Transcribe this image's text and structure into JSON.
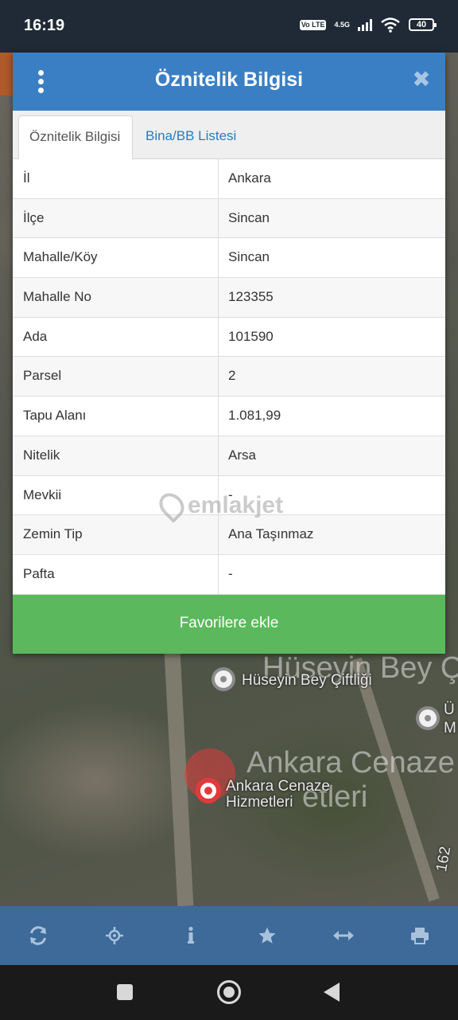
{
  "status_bar": {
    "time": "16:19",
    "volte": "Vo LTE",
    "network": "4.5G",
    "battery": "40"
  },
  "dialog": {
    "title": "Öznitelik Bilgisi",
    "tabs": [
      {
        "label": "Öznitelik Bilgisi",
        "active": true
      },
      {
        "label": "Bina/BB Listesi",
        "active": false
      }
    ],
    "rows": [
      {
        "key": "İl",
        "value": "Ankara"
      },
      {
        "key": "İlçe",
        "value": "Sincan"
      },
      {
        "key": "Mahalle/Köy",
        "value": "Sincan"
      },
      {
        "key": "Mahalle No",
        "value": "123355"
      },
      {
        "key": "Ada",
        "value": "101590"
      },
      {
        "key": "Parsel",
        "value": "2"
      },
      {
        "key": "Tapu Alanı",
        "value": "1.081,99"
      },
      {
        "key": "Nitelik",
        "value": "Arsa"
      },
      {
        "key": "Mevkii",
        "value": "-"
      },
      {
        "key": "Zemin Tip",
        "value": "Ana Taşınmaz"
      },
      {
        "key": "Pafta",
        "value": "-"
      }
    ],
    "favorite_button": "Favorilere ekle"
  },
  "watermark": "emlakjet",
  "map": {
    "labels": {
      "huseyin_big": "Hüseyin Bey Ç",
      "huseyin_small": "Hüseyin Bey Çiftliği",
      "cenaze_big": "Ankara Cenaze",
      "cenaze_big2": "etleri",
      "cenaze_small_1": "Ankara Cenaze",
      "cenaze_small_2": "Hizmetleri",
      "right_edge_1": "Ü",
      "right_edge_2": "M",
      "road_number": "162"
    }
  },
  "toolbar": {
    "icons": [
      "refresh-icon",
      "locate-icon",
      "info-icon",
      "star-icon",
      "measure-icon",
      "print-icon"
    ]
  },
  "colors": {
    "header": "#3a7fc4",
    "tab_link": "#2a7bbd",
    "favorite_button": "#5cb85c",
    "toolbar": "#3d6a98",
    "status_bar": "#1f2a36"
  }
}
